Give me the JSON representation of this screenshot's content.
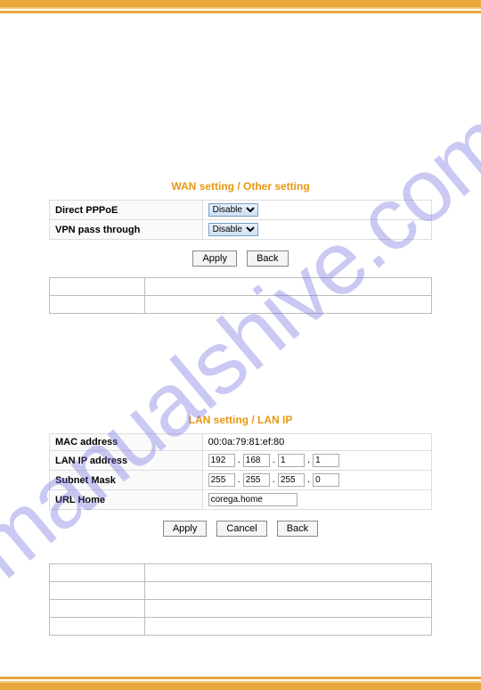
{
  "watermark": "manualshive.com",
  "wan": {
    "title": "WAN setting / Other setting",
    "rows": [
      {
        "label": "Direct PPPoE",
        "value": "Disable"
      },
      {
        "label": "VPN pass through",
        "value": "Disable"
      }
    ],
    "buttons": {
      "apply": "Apply",
      "back": "Back"
    }
  },
  "lan": {
    "title": "LAN setting / LAN IP",
    "mac_label": "MAC address",
    "mac_value": "00:0a:79:81:ef:80",
    "ip_label": "LAN IP address",
    "ip": [
      "192",
      "168",
      "1",
      "1"
    ],
    "mask_label": "Subnet Mask",
    "mask": [
      "255",
      "255",
      "255",
      "0"
    ],
    "url_label": "URL Home",
    "url_value": "corega.home",
    "buttons": {
      "apply": "Apply",
      "cancel": "Cancel",
      "back": "Back"
    }
  }
}
